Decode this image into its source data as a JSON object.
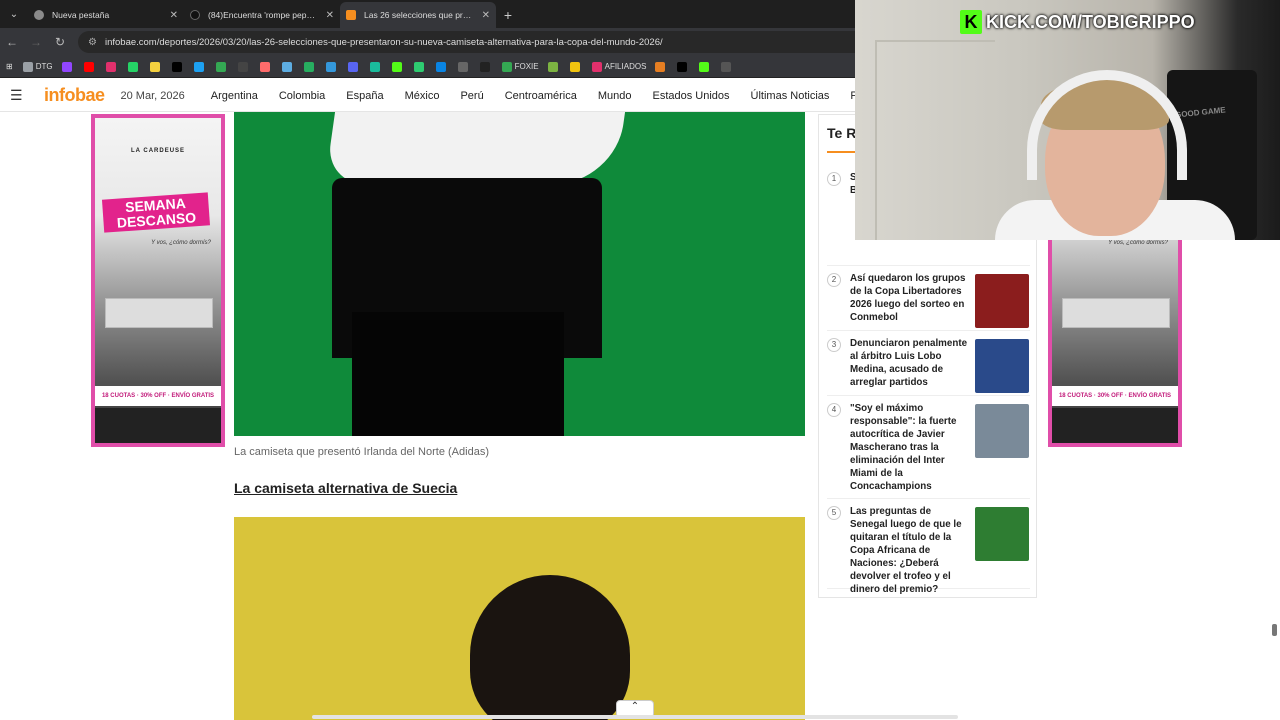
{
  "browser": {
    "tabs": [
      {
        "title": "Nueva pestaña",
        "favicon_color": "#8a8a8a"
      },
      {
        "title": "(84)Encuentra 'rompe pepe' en",
        "favicon_color": "#111111"
      },
      {
        "title": "Las 26 selecciones que present",
        "favicon_color": "#f68e1f"
      }
    ],
    "url": "infobae.com/deportes/2026/03/20/las-26-selecciones-que-presentaron-su-nueva-camiseta-alternativa-para-la-copa-del-mundo-2026/",
    "bookmarks": [
      {
        "label": "DTG",
        "color": "#9aa0a6"
      },
      {
        "label": "",
        "color": "#9146ff"
      },
      {
        "label": "",
        "color": "#ff0000"
      },
      {
        "label": "",
        "color": "#e1306c"
      },
      {
        "label": "",
        "color": "#25d366"
      },
      {
        "label": "",
        "color": "#f4d03f"
      },
      {
        "label": "",
        "color": "#000000"
      },
      {
        "label": "",
        "color": "#1da1f2"
      },
      {
        "label": "",
        "color": "#34a853"
      },
      {
        "label": "",
        "color": "#444444"
      },
      {
        "label": "",
        "color": "#ff6b6b"
      },
      {
        "label": "",
        "color": "#5dade2"
      },
      {
        "label": "",
        "color": "#27ae60"
      },
      {
        "label": "",
        "color": "#3498db"
      },
      {
        "label": "",
        "color": "#5865f2"
      },
      {
        "label": "",
        "color": "#1abc9c"
      },
      {
        "label": "",
        "color": "#53fc18"
      },
      {
        "label": "",
        "color": "#2ecc71"
      },
      {
        "label": "",
        "color": "#0984e3"
      },
      {
        "label": "",
        "color": "#666666"
      },
      {
        "label": "",
        "color": "#222222"
      },
      {
        "label": "FOXIE",
        "color": "#34a853"
      },
      {
        "label": "",
        "color": "#7cb342"
      },
      {
        "label": "",
        "color": "#f1c40f"
      },
      {
        "label": "AFILIADOS",
        "color": "#e1306c"
      },
      {
        "label": "",
        "color": "#e67e22"
      },
      {
        "label": "",
        "color": "#000000"
      },
      {
        "label": "",
        "color": "#53fc18"
      },
      {
        "label": "",
        "color": "#555555"
      }
    ]
  },
  "site": {
    "logo": "infobae",
    "date": "20 Mar, 2026",
    "nav": [
      "Argentina",
      "Colombia",
      "España",
      "México",
      "Perú",
      "Centroamérica",
      "Mundo",
      "Estados Unidos",
      "Últimas Noticias",
      "P"
    ]
  },
  "ad": {
    "brand": "LA CARDEUSE",
    "title_line1": "SEMANA",
    "title_line2": "DESCANSO",
    "subtitle": "Y vos, ¿cómo dormís?",
    "strip": "18 CUOTAS · 30% OFF · ENVÍO GRATIS"
  },
  "article": {
    "caption": "La camiseta que presentó Irlanda del Norte (Adidas)",
    "subheading": "La camiseta alternativa de Suecia"
  },
  "sidebar": {
    "title": "Te R",
    "items": [
      {
        "num": "1",
        "text": "S L J \" C Católica y Barcelona de Ecuador",
        "thumb": "#3b3b3b"
      },
      {
        "num": "2",
        "text": "Así quedaron los grupos de la Copa Libertadores 2026 luego del sorteo en Conmebol",
        "thumb": "#8b1d1d"
      },
      {
        "num": "3",
        "text": "Denunciaron penalmente al árbitro Luis Lobo Medina, acusado de arreglar partidos",
        "thumb": "#2a4a8a"
      },
      {
        "num": "4",
        "text": "\"Soy el máximo responsable\": la fuerte autocrítica de Javier Mascherano tras la eliminación del Inter Miami de la Concachampions",
        "thumb": "#7a8a99"
      },
      {
        "num": "5",
        "text": "Las preguntas de Senegal luego de que le quitaran el título de la Copa Africana de Naciones: ¿Deberá devolver el trofeo y el dinero del premio?",
        "thumb": "#2e7d32"
      }
    ]
  },
  "overlay": {
    "kick_handle": "KICK.COM/TOBIGRIPPO",
    "chair_text": "GOOD GAME"
  }
}
